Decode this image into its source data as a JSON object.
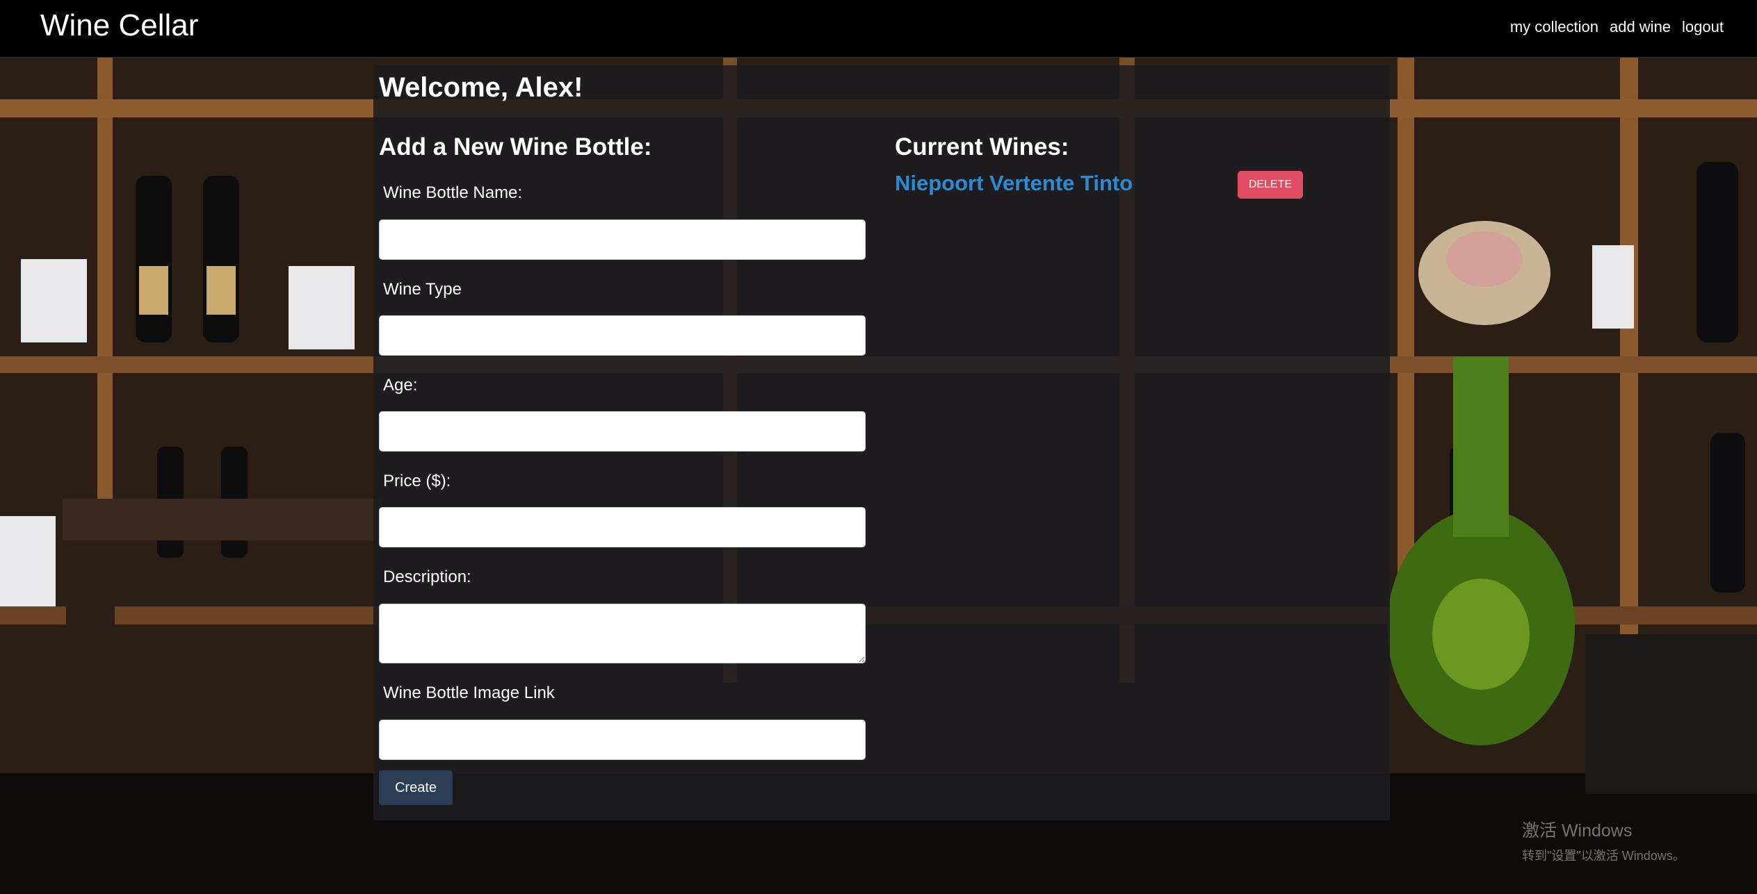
{
  "navbar": {
    "brand": "Wine Cellar",
    "links": [
      "my collection",
      "add wine",
      "logout"
    ]
  },
  "main": {
    "welcome": "Welcome, Alex!",
    "form": {
      "title": "Add a New Wine Bottle:",
      "fields": [
        {
          "label": "Wine Bottle Name:",
          "value": "",
          "placeholder": ""
        },
        {
          "label": "Wine Type",
          "value": "",
          "placeholder": ""
        },
        {
          "label": "Age:",
          "value": "",
          "placeholder": ""
        },
        {
          "label": "Price ($):",
          "value": "",
          "placeholder": ""
        },
        {
          "label": "Description:",
          "value": "",
          "placeholder": ""
        },
        {
          "label": "Wine Bottle Image Link",
          "value": "",
          "placeholder": ""
        }
      ],
      "submit_label": "Create"
    },
    "current": {
      "title": "Current Wines:",
      "wines": [
        {
          "name": "Niepoort Vertente Tinto",
          "delete_label": "DELETE"
        }
      ]
    }
  },
  "watermark": {
    "title": "激活 Windows",
    "subtitle": "转到\"设置\"以激活 Windows。"
  },
  "colors": {
    "navbar_bg": "#000000",
    "panel_bg": "#1c1c20",
    "link": "#2a8cd4",
    "delete": "#e04c62",
    "create": "#2b3e56"
  }
}
